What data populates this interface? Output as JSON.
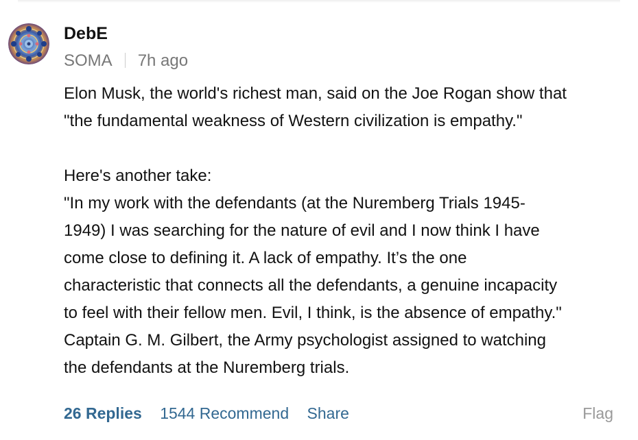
{
  "comment": {
    "author": "DebE",
    "location": "SOMA",
    "time_ago": "7h ago",
    "paragraphs": [
      "Elon Musk, the world's richest man, said on the Joe Rogan show that\n\"the fundamental weakness of Western civilization is empathy.\"",
      "Here's another take:\n\"In my work with the defendants (at the Nuremberg Trials 1945-\n1949) I was searching for the nature of evil and I now think I have\ncome close to defining it. A lack of empathy. It’s the one\ncharacteristic that connects all the defendants, a genuine incapacity\nto feel with their fellow men. Evil, I think, is the absence of empathy.\"\nCaptain G. M. Gilbert, the Army psychologist assigned to watching\nthe defendants at the Nuremberg trials."
    ]
  },
  "actions": {
    "replies_label": "26 Replies",
    "recommend_label": "1544 Recommend",
    "share_label": "Share",
    "flag_label": "Flag"
  },
  "colors": {
    "link": "#326891",
    "meta": "#777777",
    "flag": "#999999",
    "text": "#121212"
  }
}
